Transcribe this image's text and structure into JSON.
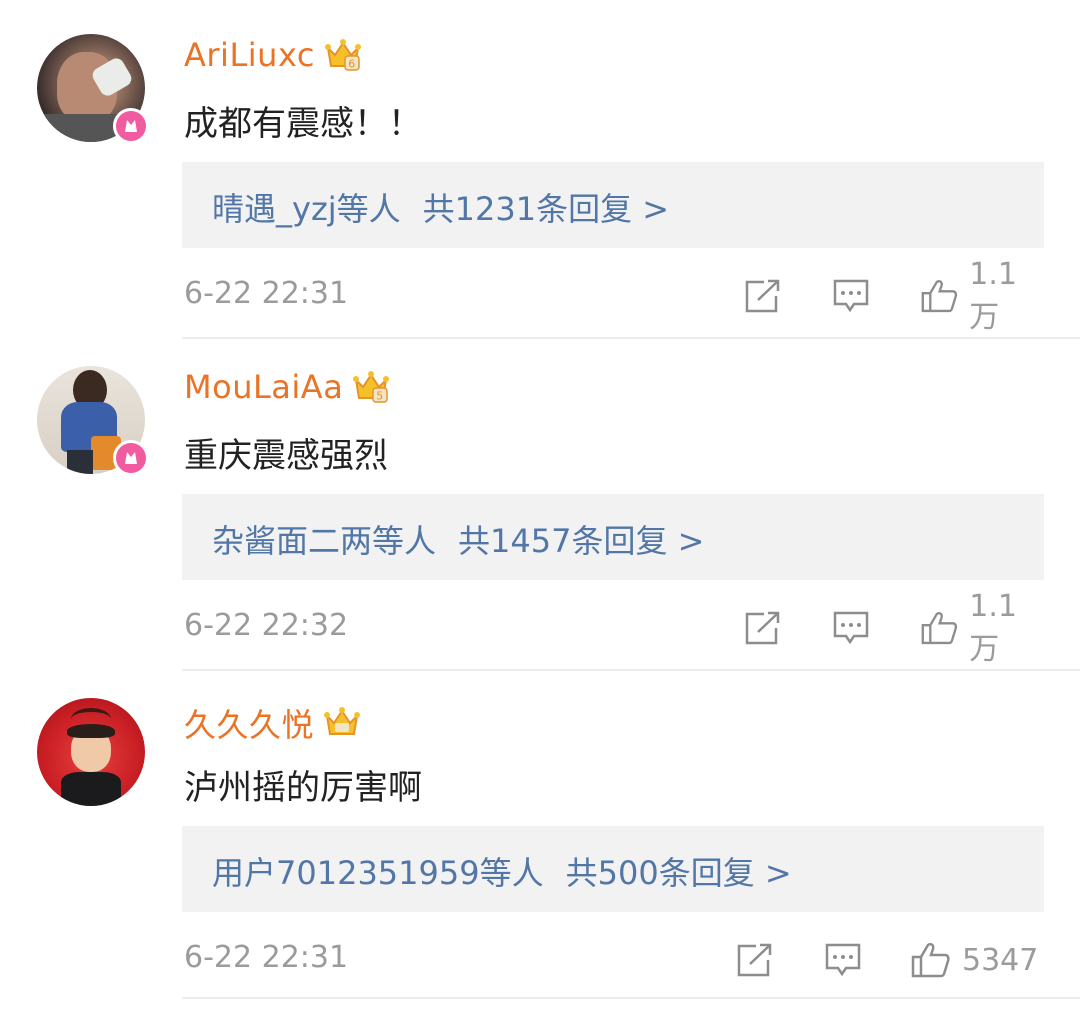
{
  "comments": [
    {
      "username": "AriLiuxc",
      "content": "成都有震感！！",
      "reply_users": "晴遇_yzj等人",
      "reply_count": "共1231条回复 >",
      "timestamp": "6-22 22:31",
      "likes": "1.1万",
      "crown_level": "6"
    },
    {
      "username": "MouLaiAa",
      "content": "重庆震感强烈",
      "reply_users": "杂酱面二两等人",
      "reply_count": "共1457条回复 >",
      "timestamp": "6-22 22:32",
      "likes": "1.1万",
      "crown_level": "5"
    },
    {
      "username": "久久久悦",
      "content": "泸州摇的厉害啊",
      "reply_users": "用户7012351959等人",
      "reply_count": "共500条回复 >",
      "timestamp": "6-22 22:31",
      "likes": "5347",
      "crown_level": ""
    }
  ],
  "icons": {
    "share": "share-icon",
    "comment": "comment-icon",
    "like": "thumbs-up-icon",
    "crown": "vip-crown-icon",
    "badge": "verified-badge-icon"
  },
  "colors": {
    "username": "#eb7325",
    "reply_link": "#5276a6",
    "meta": "#9b9b9b",
    "reply_bg": "#f2f2f2",
    "badge": "#f15ca1"
  }
}
